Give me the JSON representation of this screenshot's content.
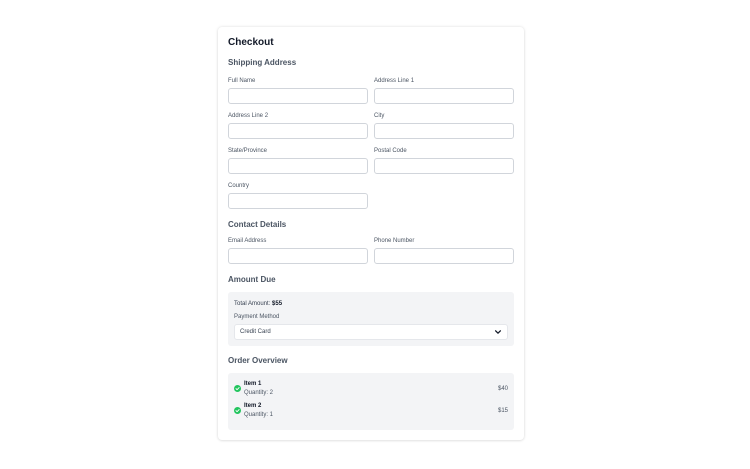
{
  "checkout": {
    "title": "Checkout"
  },
  "shipping": {
    "heading": "Shipping Address",
    "full_name_label": "Full Name",
    "full_name_value": "",
    "address1_label": "Address Line 1",
    "address1_value": "",
    "address2_label": "Address Line 2",
    "address2_value": "",
    "city_label": "City",
    "city_value": "",
    "state_label": "State/Province",
    "state_value": "",
    "postal_label": "Postal Code",
    "postal_value": "",
    "country_label": "Country",
    "country_value": ""
  },
  "contact": {
    "heading": "Contact Details",
    "email_label": "Email Address",
    "email_value": "",
    "phone_label": "Phone Number",
    "phone_value": ""
  },
  "amount": {
    "heading": "Amount Due",
    "total_label": "Total Amount:",
    "total_value": "$55",
    "payment_label": "Payment Method",
    "payment_selected": "Credit Card"
  },
  "order": {
    "heading": "Order Overview",
    "items": [
      {
        "name": "Item 1",
        "quantity": "Quantity: 2",
        "price": "$40",
        "icon": "check-circle-icon"
      },
      {
        "name": "Item 2",
        "quantity": "Quantity: 1",
        "price": "$15",
        "icon": "check-circle-icon"
      }
    ]
  },
  "colors": {
    "accent_green": "#22c55e",
    "panel_bg": "#f3f4f6",
    "border": "#d1d5db"
  }
}
